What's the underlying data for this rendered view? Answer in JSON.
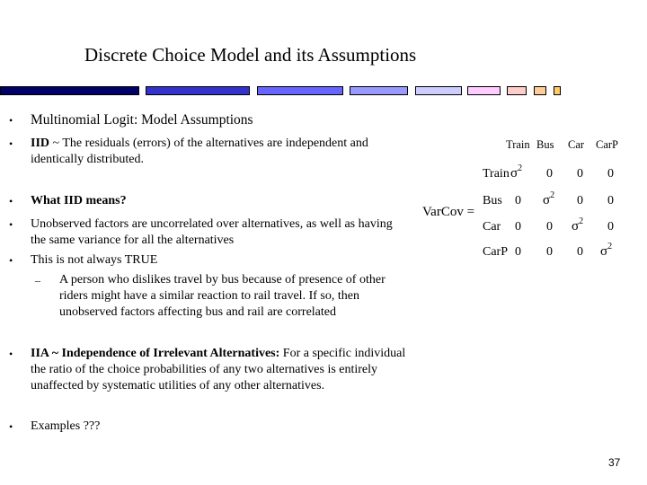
{
  "slide": {
    "title": "Discrete Choice Model and its Assumptions",
    "page_number": "37",
    "decor_bar_colors": [
      "#000066",
      "#3333cc",
      "#6666ff",
      "#9999ff",
      "#ccccff",
      "#ffccff",
      "#ffcccc",
      "#ffcc99",
      "#ffcc66"
    ]
  },
  "bullets": [
    {
      "marker": "•",
      "text": "Multinomial Logit: Model Assumptions"
    },
    {
      "marker": "•",
      "bold": "IID",
      "text": " ~ The residuals (errors) of the alternatives are independent and identically distributed."
    },
    {
      "marker": "•",
      "bold": "What IID means?",
      "text": ""
    },
    {
      "marker": "•",
      "text": "Unobserved factors are uncorrelated over alternatives, as well as having the same variance for all the alternatives"
    },
    {
      "marker": "•",
      "text": "This is not always TRUE"
    },
    {
      "marker": "–",
      "text": "A person who dislikes travel by bus because of presence of other riders might have a similar reaction to rail travel. If so, then unobserved factors affecting bus and rail are correlated"
    },
    {
      "marker": "•",
      "bold": "IIA ~ Independence of Irrelevant Alternatives:",
      "text": " For a specific individual the ratio of the choice probabilities of any two alternatives is entirely unaffected by systematic utilities of any other alternatives."
    },
    {
      "marker": "•",
      "text": "Examples  ???"
    }
  ],
  "matrix": {
    "label": "VarCov =",
    "column_headers": [
      "Train",
      "Bus",
      "Car",
      "CarP"
    ],
    "row_labels": [
      "Train",
      "Bus",
      "Car",
      "CarP"
    ],
    "sigma_symbol": "σ",
    "sigma_exponent": "2",
    "zero": "0",
    "cells": [
      [
        "σ²",
        "0",
        "0",
        "0"
      ],
      [
        "0",
        "σ²",
        "0",
        "0"
      ],
      [
        "0",
        "0",
        "σ²",
        "0"
      ],
      [
        "0",
        "0",
        "0",
        "σ²"
      ]
    ]
  }
}
